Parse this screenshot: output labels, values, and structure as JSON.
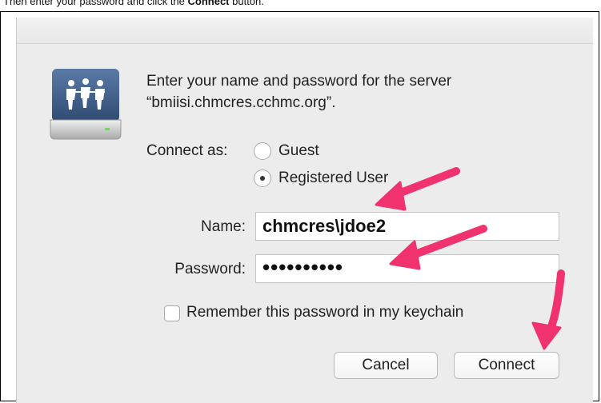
{
  "caption": {
    "prefix": "Then enter your password and click the ",
    "emphasis": "Connect",
    "suffix": " button."
  },
  "dialog": {
    "prompt_line1": "Enter your name and password for the server",
    "prompt_line2": "“bmiisi.chmcres.cchmc.org”.",
    "connect_as_label": "Connect as:",
    "options": [
      "Guest",
      "Registered User"
    ],
    "selected_option": "Registered User",
    "name_label": "Name:",
    "name_value": "chmcres\\jdoe2",
    "password_label": "Password:",
    "password_value": "••••••••••",
    "remember_label": "Remember this password in my keychain",
    "remember_checked": false,
    "cancel_label": "Cancel",
    "connect_label": "Connect"
  },
  "colors": {
    "annotation_arrow": "#f0326e",
    "dialog_bg": "#ececec",
    "icon_blue": "#3f5f8a"
  },
  "icons": [
    "shared-server-icon",
    "annotation-arrow"
  ]
}
